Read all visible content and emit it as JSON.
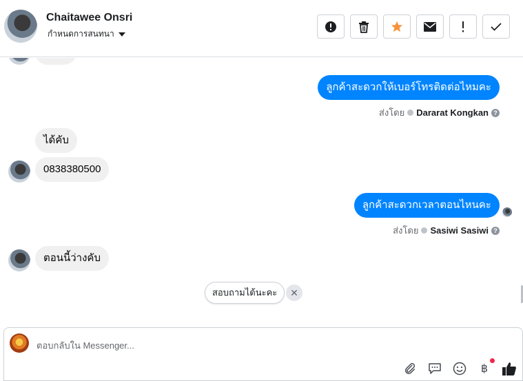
{
  "header": {
    "contact_name": "Chaitawee Onsri",
    "assign_label": "กำหนดการสนทนา",
    "actions": [
      {
        "name": "spam-button",
        "icon": "alert-circle-icon"
      },
      {
        "name": "delete-button",
        "icon": "trash-icon"
      },
      {
        "name": "star-button",
        "icon": "star-icon"
      },
      {
        "name": "mark-unread-button",
        "icon": "envelope-icon"
      },
      {
        "name": "follow-up-button",
        "icon": "exclamation-icon"
      },
      {
        "name": "mark-done-button",
        "icon": "check-icon"
      }
    ],
    "star_color": "#f7923a"
  },
  "messages": {
    "out_1": "ลูกค้าสะดวกให้เบอร์โทรติดต่อไหมคะ",
    "out_1_sentby_prefix": "ส่งโดย",
    "out_1_sender": "Dararat Kongkan",
    "in_1": "ได้คับ",
    "in_2": "0838380500",
    "out_2": "ลูกค้าสะดวกเวลาตอนไหนคะ",
    "out_2_sentby_prefix": "ส่งโดย",
    "out_2_sender": "Sasiwi Sasiwi",
    "in_3": "ตอนนี้ว่างคับ"
  },
  "suggestion": {
    "label": "สอบถามได้นะคะ",
    "close_symbol": "✕"
  },
  "composer": {
    "placeholder": "ตอบกลับใน Messenger...",
    "tools": [
      "paperclip-icon",
      "chat-bubble-icon",
      "emoji-icon",
      "baht-icon",
      "thumbs-up-icon"
    ],
    "baht_symbol": "฿"
  },
  "colors": {
    "outgoing_bubble": "#0084ff",
    "incoming_bubble": "#f0f0f0",
    "notification_dot": "#f02849"
  }
}
